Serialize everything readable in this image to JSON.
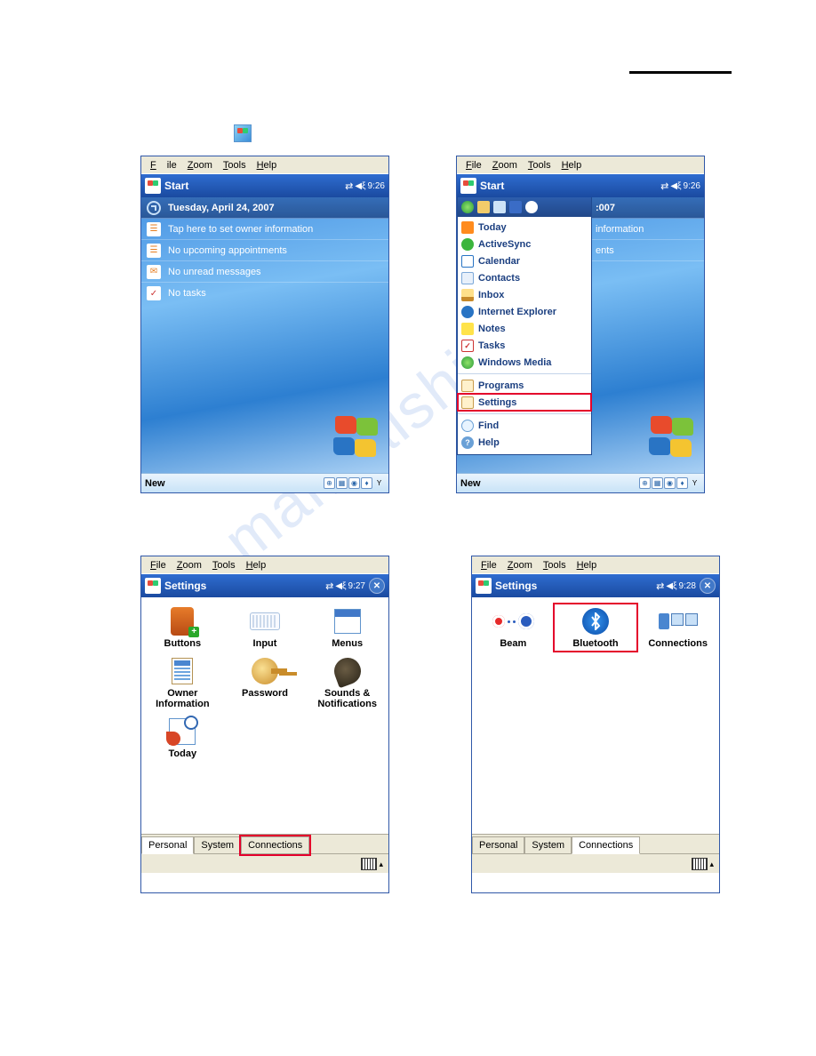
{
  "menubar": {
    "file": "File",
    "zoom": "Zoom",
    "tools": "Tools",
    "help": "Help"
  },
  "titlebar": {
    "start": "Start",
    "settings": "Settings",
    "time_926": "9:26",
    "time_927": "9:27",
    "time_928": "9:28"
  },
  "today": {
    "date": "Tuesday, April 24, 2007",
    "owner": "Tap here to set owner information",
    "appts": "No upcoming appointments",
    "msgs": "No unread messages",
    "tasks": "No tasks",
    "new": "New"
  },
  "startmenu": {
    "peek_info": "information",
    "peek_ents": "ents",
    "peek_year": ":007",
    "items": {
      "today": "Today",
      "activesync": "ActiveSync",
      "calendar": "Calendar",
      "contacts": "Contacts",
      "inbox": "Inbox",
      "ie": "Internet Explorer",
      "notes": "Notes",
      "tasks": "Tasks",
      "wm": "Windows Media",
      "programs": "Programs",
      "settings": "Settings",
      "find": "Find",
      "help": "Help"
    }
  },
  "settings_personal": {
    "icons": {
      "buttons": "Buttons",
      "input": "Input",
      "menus": "Menus",
      "owner": "Owner Information",
      "password": "Password",
      "sounds": "Sounds & Notifications",
      "today": "Today"
    }
  },
  "settings_conn": {
    "icons": {
      "beam": "Beam",
      "bluetooth": "Bluetooth",
      "connections": "Connections"
    }
  },
  "tabs": {
    "personal": "Personal",
    "system": "System",
    "connections": "Connections"
  },
  "watermark": "manualshive.com"
}
